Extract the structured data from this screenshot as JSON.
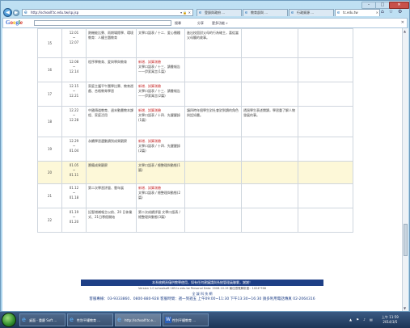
{
  "browser": {
    "url": "http://schoolf.tc.edu.tw/sp.jsp",
    "address_controls": "▾ 🔒 ✕",
    "tabs": [
      {
        "label": "登錄與政府 ...",
        "active": false
      },
      {
        "label": "教育部與 ...",
        "active": false
      },
      {
        "label": "行政資源 ...",
        "active": false
      },
      {
        "label": "tc.edu.tw",
        "active": true
      }
    ],
    "window_controls": {
      "minimize": "–",
      "maximize": "□",
      "close": "✕"
    },
    "corner_icons": "⌂ ☆ ⚙"
  },
  "toolbar": {
    "logo": "Google",
    "search_button": "搜尋",
    "items": [
      "分享",
      "更多功能 »"
    ],
    "close": "✕"
  },
  "change_label": "新增．試算測驗",
  "rows": [
    {
      "week": "15",
      "dates": "12.01\n~\n12.07",
      "topic": "熱機能比賽、雨期場館學、環境教育：人權主題教育",
      "change": "",
      "content": "文學口語表 / 十二．愛心播種",
      "note": "進出校園對父母的行為確主，喜從當父母觸的故事。",
      "outcome": "",
      "highlight": false
    },
    {
      "week": "16",
      "dates": "12.08\n~\n12.14",
      "topic": "程序學教育、愛與學與教育",
      "change": "新增．試算測驗",
      "content": "文學口語表 / 十三．讀書報告——伊索寓言(1篇)",
      "note": "",
      "outcome": "",
      "highlight": false
    },
    {
      "week": "17",
      "dates": "12.15\n~\n12.21",
      "topic": "家庭主護平午團學比賽、教育遊戲、合格教育學習",
      "change": "新增．試算測驗",
      "content": "文學口語表 / 十三．讀書報告——伊索寓言(2篇)",
      "note": "",
      "outcome": "",
      "highlight": false
    },
    {
      "week": "18",
      "dates": "12.22\n~\n12.28",
      "topic": "中國傳道教育、週末動畫教本課程、家庭活用",
      "change": "新增．試算測驗",
      "content": "文學口語表 / 十四．先醒醒錄(1篇)",
      "note": "讓四時年個學生對社會對到讀的角色與話如畫。",
      "outcome": "透過學生表述閱讀，學習重了解人物發展的事。",
      "highlight": false
    },
    {
      "week": "19",
      "dates": "12.29\n~\n01.04",
      "topic": "永續學習選動讀到成果觀察",
      "change": "新增．試算測驗",
      "content": "文學口語表 / 十四．先醒醒錄(2篇)",
      "note": "",
      "outcome": "",
      "highlight": false
    },
    {
      "week": "20",
      "dates": "01.05\n~\n01.11",
      "topic": "籌備成果觀察",
      "change": "",
      "content": "文學口語表 / 總整理與動態(1篇)",
      "note": "",
      "outcome": "",
      "highlight": true
    },
    {
      "week": "21",
      "dates": "01.12\n~\n01.18",
      "topic": "第二次學習評量、雲年展",
      "change": "新增．試算測驗",
      "content": "文學口語表 / 總整理與動態(2篇)",
      "note": "",
      "outcome": "",
      "highlight": false
    },
    {
      "week": "22",
      "dates": "01.19\n~\n01.20",
      "topic": "記暫增補報主以前、20 日休業式、21日寒假開始",
      "change": "",
      "content": "第二次成績評量 文學口語表 / 總整理與動態(3篇)",
      "note": "",
      "outcome": "",
      "highlight": false
    }
  ],
  "footer": {
    "bar": "本系統網頁僅供教學使用，如有任何建議請與系統管理員聯繫，謝謝！",
    "version": "Version 1.0  schoolsoft 165.tc.edu.tw     Personal Data: 2008.10.19   最佳瀏覽解析度：1024*768",
    "org": "全 誠 科 技 網",
    "contact": "客服專線：03-9333860．0800-880-928  客服時間：週一到週五 上午09:00~11:30 下午13:30~16:30  請多利用電話傳真 02-2064316"
  },
  "taskbar": {
    "tasks": [
      {
        "label": "桌面 - 重慶 Soft ...",
        "icon": "ie",
        "active": false
      },
      {
        "label": "性別平權教育 ...",
        "icon": "ie",
        "active": false
      },
      {
        "label": "http://schoolf.tc.e...",
        "icon": "ie",
        "active": true
      },
      {
        "label": "性別平權教育 ...",
        "icon": "word",
        "active": false
      }
    ],
    "time": "上午 11:59",
    "date": "2014/3/5",
    "tray_icons": "▲ ⚑ ♪ ▤"
  }
}
